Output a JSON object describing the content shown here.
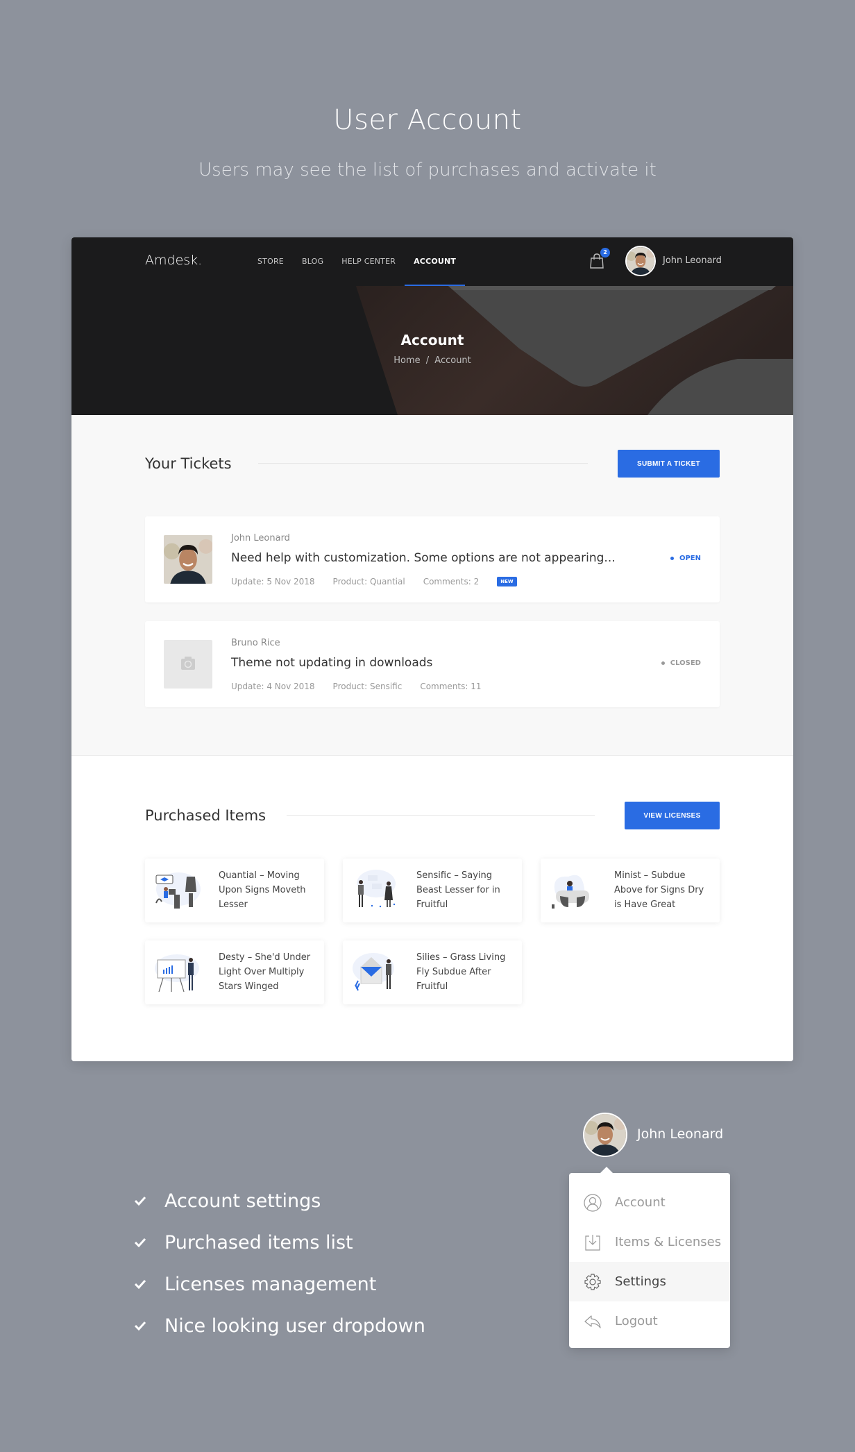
{
  "hero": {
    "title": "User Account",
    "subtitle": "Users may see the list of purchases and activate it"
  },
  "navbar": {
    "logo": "Amdesk.",
    "links": [
      {
        "label": "STORE",
        "active": false
      },
      {
        "label": "BLOG",
        "active": false
      },
      {
        "label": "HELP CENTER",
        "active": false
      },
      {
        "label": "ACCOUNT",
        "active": true
      }
    ],
    "cart_count": "2",
    "user_name": "John Leonard"
  },
  "banner": {
    "title": "Account",
    "breadcrumb": [
      "Home",
      "/",
      "Account"
    ]
  },
  "tickets": {
    "title": "Your Tickets",
    "submit_label": "SUBMIT A TICKET",
    "items": [
      {
        "author": "John Leonard",
        "subject": "Need help with customization. Some options are not appearing...",
        "update": "Update: 5 Nov 2018",
        "product": "Product: Quantial",
        "comments": "Comments: 2",
        "badge": "NEW",
        "status": "OPEN",
        "thumb": "avatar"
      },
      {
        "author": "Bruno Rice",
        "subject": "Theme not updating in downloads",
        "update": "Update: 4 Nov 2018",
        "product": "Product: Sensific",
        "comments": "Comments: 11",
        "badge": "",
        "status": "CLOSED",
        "thumb": "camera-placeholder"
      }
    ]
  },
  "purchased": {
    "title": "Purchased Items",
    "view_label": "VIEW LICENSES",
    "items": [
      {
        "title": "Quantial – Moving Upon Signs Moveth Lesser"
      },
      {
        "title": "Sensific – Saying Beast Lesser for in Fruitful"
      },
      {
        "title": "Minist – Subdue Above for Signs Dry is Have Great"
      },
      {
        "title": "Desty – She'd Under Light Over Multiply Stars Winged"
      },
      {
        "title": "Silies – Grass Living Fly Subdue After Fruitful"
      }
    ]
  },
  "features": [
    "Account settings",
    "Purchased items list",
    "Licenses management",
    "Nice looking user dropdown"
  ],
  "user_dropdown": {
    "user_name": "John Leonard",
    "items": [
      {
        "label": "Account",
        "icon": "user-icon",
        "active": false
      },
      {
        "label": "Items & Licenses",
        "icon": "download-icon",
        "active": false
      },
      {
        "label": "Settings",
        "icon": "gear-icon",
        "active": true
      },
      {
        "label": "Logout",
        "icon": "logout-icon",
        "active": false
      }
    ]
  },
  "colors": {
    "accent": "#2a6ce3",
    "page_bg": "#8d929c",
    "navbar_bg": "#1b1b1c"
  }
}
